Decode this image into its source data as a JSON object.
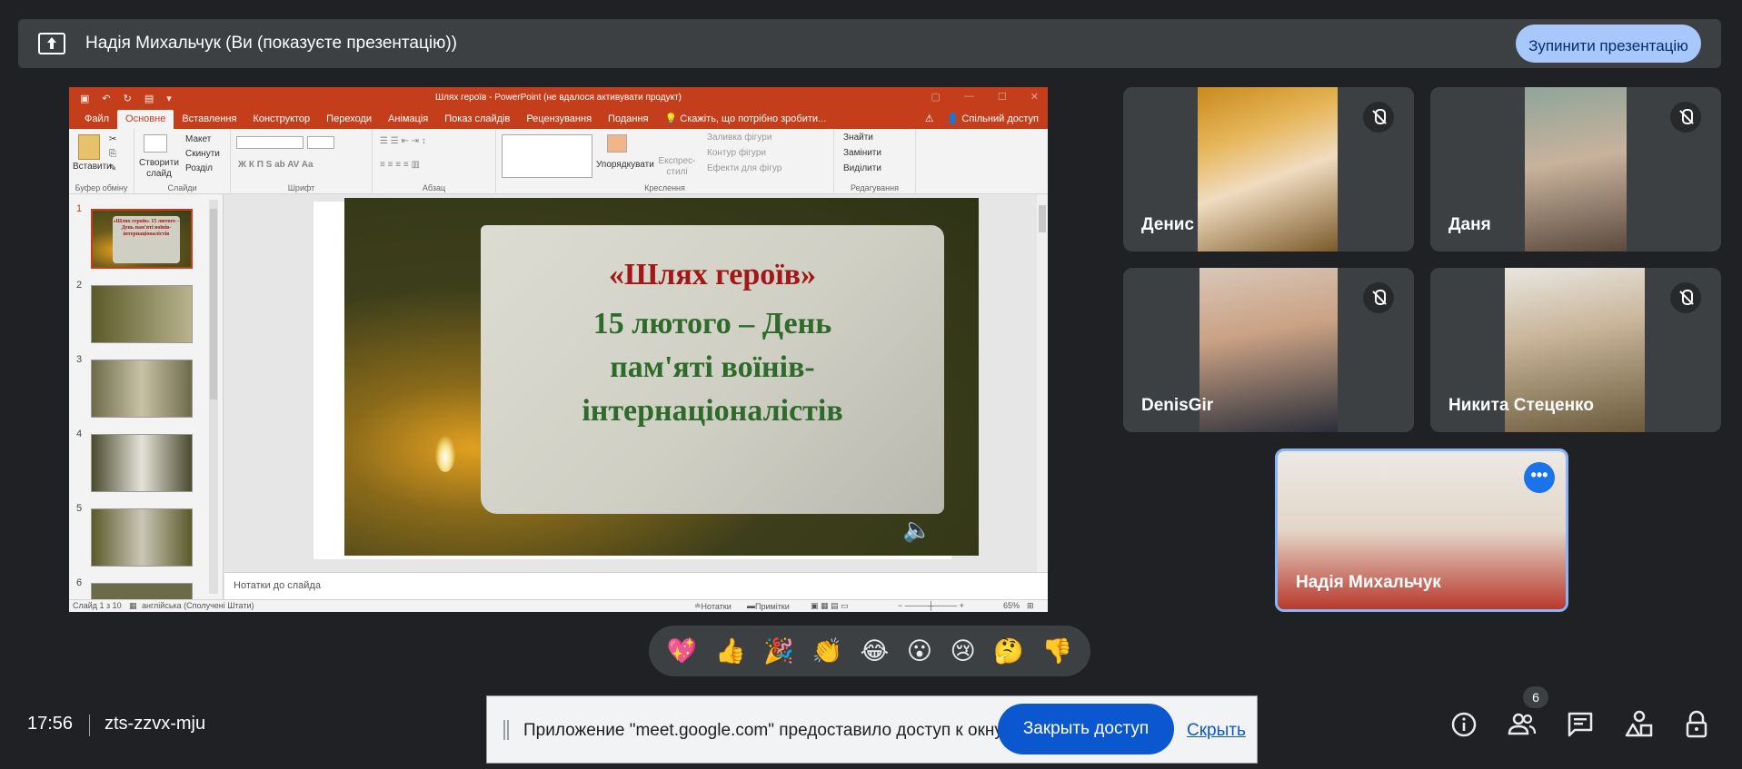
{
  "presenting": {
    "text": "Надія Михальчук (Ви (показуєте презентацію))",
    "stop_label": "Зупинити презентацію"
  },
  "ppt": {
    "window_title": "Шлях героїв - PowerPoint (не вдалося активувати продукт)",
    "tabs": [
      "Файл",
      "Основне",
      "Вставлення",
      "Конструктор",
      "Переходи",
      "Анімація",
      "Показ слайдів",
      "Рецензування",
      "Подання"
    ],
    "tell_me": "Скажіть, що потрібно зробити...",
    "share": "Спільний доступ",
    "ribbon": {
      "paste": "Вставити",
      "clipboard": "Буфер обміну",
      "new_slide": "Створити слайд",
      "layout": "Макет",
      "reset": "Скинути",
      "section": "Розділ",
      "slides": "Слайди",
      "font": "Шрифт",
      "paragraph": "Абзац",
      "arrange": "Упорядкувати",
      "quick_styles": "Експрес-стилі",
      "shape_fill": "Заливка фігури",
      "shape_outline": "Контур фігури",
      "shape_effects": "Ефекти для фігур",
      "drawing": "Креслення",
      "find": "Знайти",
      "replace": "Замінити",
      "select": "Виділити",
      "editing": "Редагування"
    },
    "thumbnails": [
      "1",
      "2",
      "3",
      "4",
      "5",
      "6"
    ],
    "thumb1_text": "«Шлях героїв» 15 лютого – День пам'яті воїнів-інтернаціоналістів",
    "slide": {
      "title": "«Шлях героїв»",
      "line1": "15 лютого – День",
      "line2": "пам'яті воїнів-",
      "line3": "інтернаціоналістів"
    },
    "notes_placeholder": "Нотатки до слайда",
    "status": {
      "slide_of": "Слайд 1 з 10",
      "language": "англійська (Сполучені Штати)",
      "notes": "Нотатки",
      "comments": "Примітки",
      "zoom": "65%"
    }
  },
  "participants": [
    {
      "name": "Денис"
    },
    {
      "name": "Даня"
    },
    {
      "name": "DenisGir"
    },
    {
      "name": "Никита Стеценко"
    },
    {
      "name": "Надія Михальчук"
    }
  ],
  "reactions": [
    "💖",
    "👍",
    "🎉",
    "👏",
    "😂",
    "😮",
    "😢",
    "🤔",
    "👎"
  ],
  "bottom": {
    "time": "17:56",
    "meeting_code": "zts-zzvx-mju",
    "participants_count": "6"
  },
  "share_banner": {
    "text": "Приложение \"meet.google.com\" предоставило доступ к окну.",
    "close_label": "Закрыть доступ",
    "hide_label": "Скрыть"
  },
  "icons": [
    "present-to-all-icon",
    "mic-off-icon",
    "more-icon",
    "info-icon",
    "people-icon",
    "chat-icon",
    "activities-icon",
    "host-controls-icon",
    "speaker-icon"
  ]
}
